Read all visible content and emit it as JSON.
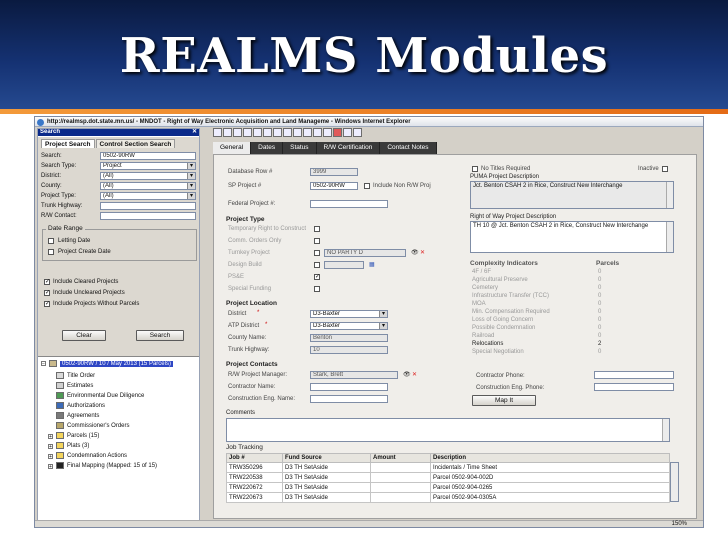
{
  "slide_title": "REALMS Modules",
  "window_title": "http://realmsp.dot.state.mn.us/ - MNDOT - Right of Way Electronic Acquisition and Land Manageme - Windows Internet Explorer",
  "search_panel": {
    "header": "Search",
    "tabs": [
      "Project Search",
      "Control Section Search"
    ],
    "fields": [
      {
        "label": "Search:",
        "value": "0502-90RW"
      },
      {
        "label": "Search Type:",
        "value": "Project"
      },
      {
        "label": "District:",
        "value": "(All)"
      },
      {
        "label": "County:",
        "value": "(All)"
      },
      {
        "label": "Project Type:",
        "value": "(All)"
      },
      {
        "label": "Trunk Highway:",
        "value": ""
      },
      {
        "label": "R/W Contact:",
        "value": ""
      }
    ],
    "date_range_title": "Date Range",
    "date_checks": [
      "Letting Date",
      "Project Create Date"
    ],
    "include_checks": [
      "Include Cleared Projects",
      "Include Uncleared Projects",
      "Include Projects Without Parcels"
    ],
    "clear_button": "Clear",
    "search_button": "Search"
  },
  "tree": {
    "root": "0502-90RW / 10 / May 2013 (15 Parcels)",
    "items": [
      "Title Order",
      "Estimates",
      "Environmental Due Diligence",
      "Authorizations",
      "Agreements",
      "Commissioner's Orders"
    ],
    "folders": [
      "Parcels (15)",
      "Plats (3)",
      "Condemnation Actions",
      "Final Mapping (Mapped: 15 of 15)"
    ]
  },
  "tabs": [
    "General",
    "Dates",
    "Status",
    "R/W Certification",
    "Contact Notes"
  ],
  "general": {
    "database_row_label": "Database Row #",
    "database_row_value": "3999",
    "sp_project_label": "SP Project #",
    "sp_project_value": "0502-90RW",
    "include_non_rw_label": "Include Non R/W Proj",
    "federal_project_label": "Federal Project #:",
    "project_type_title": "Project Type",
    "project_type_items": [
      "Temporary Right to Construct",
      "Comm. Orders Only",
      "Turnkey Project",
      "Design Build",
      "PS&E",
      "Special Funding"
    ],
    "turnkey_value": "NO PARTY D",
    "project_location_title": "Project Location",
    "district_label": "District",
    "district_value": "D3-Baxter",
    "atp_label": "ATP District",
    "atp_value": "D3-Baxter",
    "county_label": "County Name:",
    "county_value": "Benton",
    "trunk_label": "Trunk Highway:",
    "trunk_value": "10",
    "contacts_title": "Project Contacts",
    "rw_manager_label": "R/W Project Manager:",
    "rw_manager_value": "Stark, Brett",
    "contractor_label": "Contractor Name:",
    "construction_eng_label": "Construction Eng. Name:",
    "comments_label": "Comments",
    "no_titles_label": "No Titles Required",
    "inactive_label": "Inactive",
    "puma_title": "PUMA Project Description",
    "puma_text": "Jct. Benton CSAH 2 in Rice, Construct New Interchange",
    "row_desc_title": "Right of Way Project Description",
    "row_desc_text": "TH 10 @ Jct. Benton CSAH 2 in Rice, Construct New Interchange",
    "complexity_title": "Complexity Indicators",
    "parcels_title": "Parcels",
    "complexity": [
      {
        "name": "4F / 6F",
        "count": "0"
      },
      {
        "name": "Agricultural Preserve",
        "count": "0"
      },
      {
        "name": "Cemetery",
        "count": "0"
      },
      {
        "name": "Infrastructure Transfer (TCC)",
        "count": "0"
      },
      {
        "name": "MOA",
        "count": "0"
      },
      {
        "name": "Min. Compensation Required",
        "count": "0"
      },
      {
        "name": "Loss of Going Concern",
        "count": "0"
      },
      {
        "name": "Possible Condemnation",
        "count": "0"
      },
      {
        "name": "Railroad",
        "count": "0"
      },
      {
        "name": "Relocations",
        "count": "2"
      },
      {
        "name": "Special Negotiation",
        "count": "0"
      }
    ],
    "contractor_phone_label": "Contractor Phone:",
    "construction_phone_label": "Construction Eng. Phone:",
    "map_button": "Map It"
  },
  "job_tracking": {
    "title": "Job Tracking",
    "columns": [
      "Job #",
      "Fund Source",
      "Amount",
      "Description"
    ],
    "rows": [
      [
        "TRW350296",
        "D3 TH SetAside",
        "",
        "Incidentals / Time Sheet"
      ],
      [
        "TRW220538",
        "D3 TH SetAside",
        "",
        "Parcel 0502-904-002D"
      ],
      [
        "TRW220672",
        "D3 TH SetAside",
        "",
        "Parcel 0502-904-0265"
      ],
      [
        "TRW220673",
        "D3 TH SetAside",
        "",
        "Parcel 0502-904-0305A"
      ]
    ]
  },
  "zoom": "150%"
}
